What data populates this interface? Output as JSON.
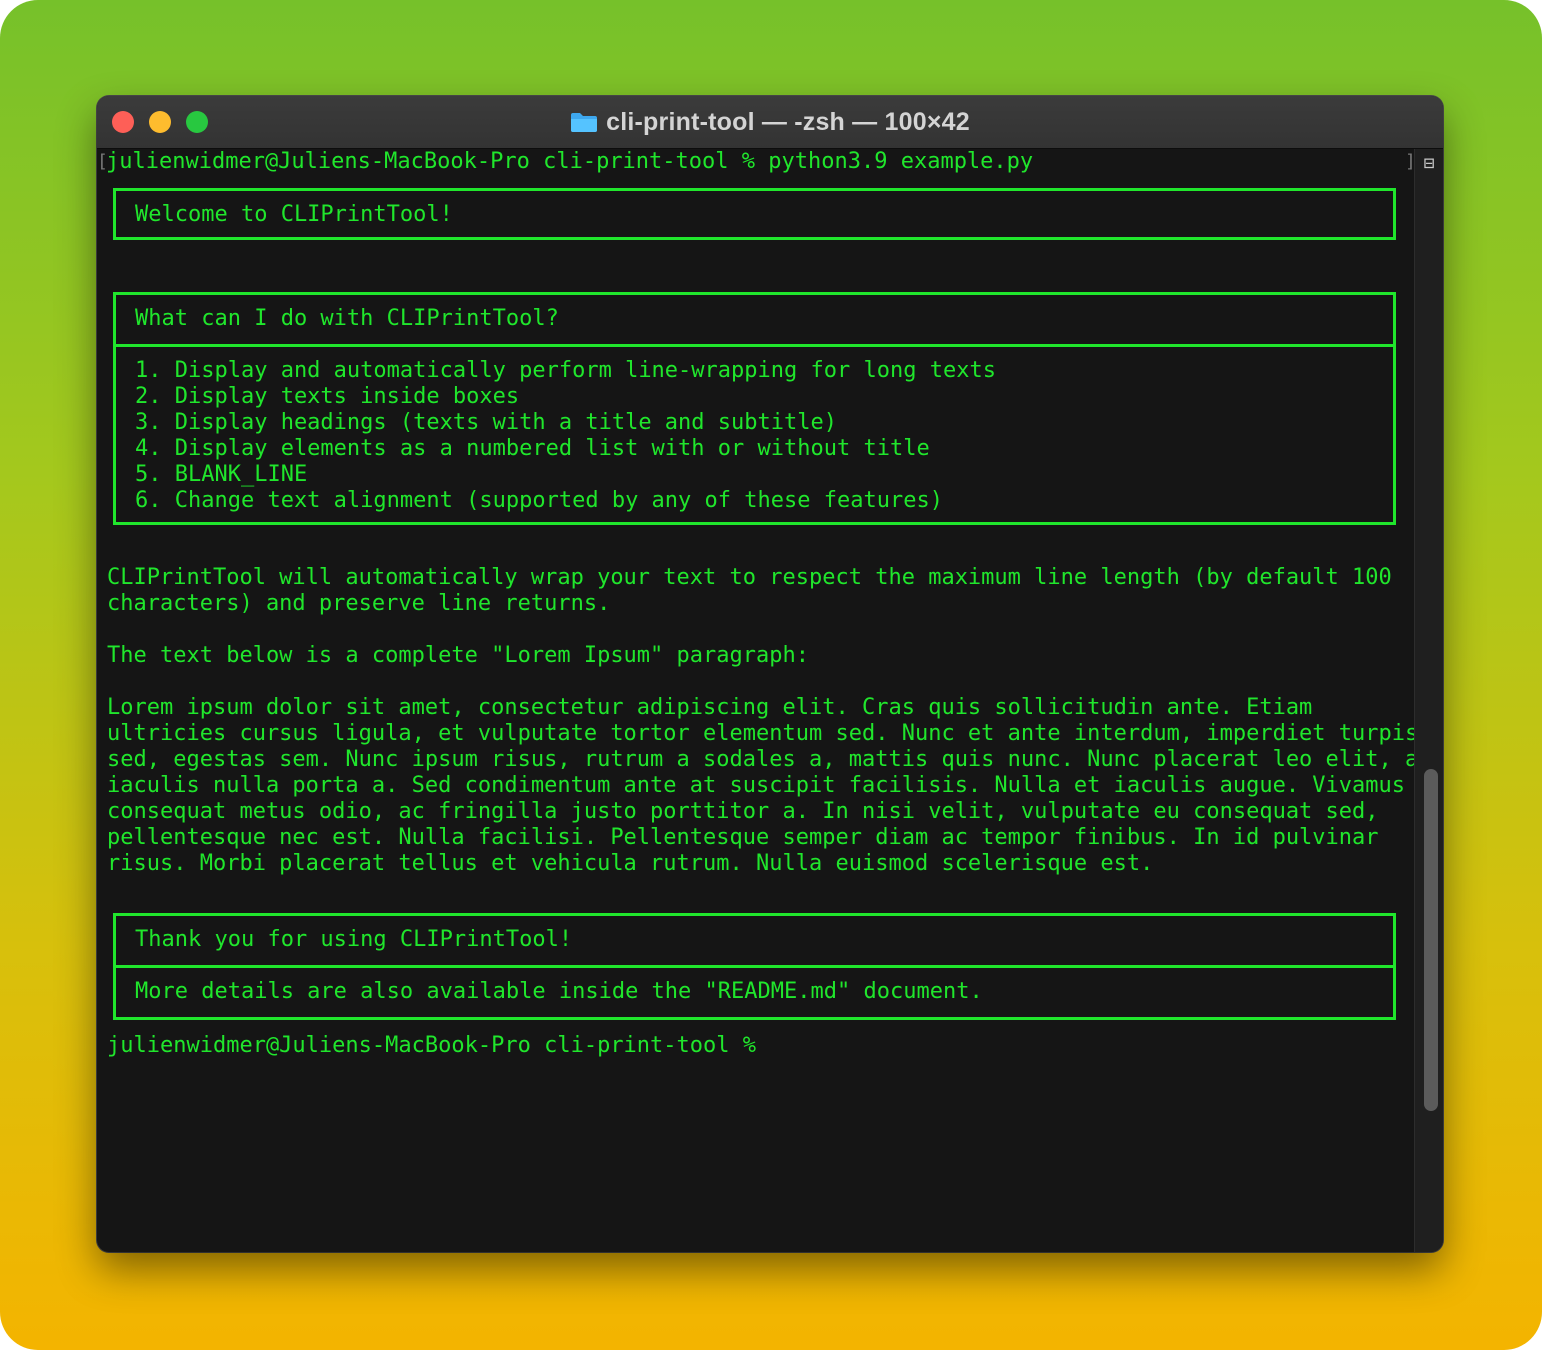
{
  "window": {
    "title": "cli-print-tool — -zsh — 100×42"
  },
  "terminal": {
    "command_line": "julienwidmer@Juliens-MacBook-Pro cli-print-tool % python3.9 example.py",
    "welcome": "Welcome to CLIPrintTool!",
    "features_heading": "What can I do with CLIPrintTool?",
    "features": [
      "1. Display and automatically perform line-wrapping for long texts",
      "2. Display texts inside boxes",
      "3. Display headings (texts with a title and subtitle)",
      "4. Display elements as a numbered list with or without title",
      "5. BLANK_LINE",
      "6. Change text alignment (supported by any of these features)"
    ],
    "paragraph1": [
      "CLIPrintTool will automatically wrap your text to respect the maximum line length (by default 100",
      "characters) and preserve line returns."
    ],
    "paragraph2": "The text below is a complete \"Lorem Ipsum\" paragraph:",
    "lorem": [
      "Lorem ipsum dolor sit amet, consectetur adipiscing elit. Cras quis sollicitudin ante. Etiam",
      "ultricies cursus ligula, et vulputate tortor elementum sed. Nunc et ante interdum, imperdiet turpis",
      "sed, egestas sem. Nunc ipsum risus, rutrum a sodales a, mattis quis nunc. Nunc placerat leo elit, at",
      "iaculis nulla porta a. Sed condimentum ante at suscipit facilisis. Nulla et iaculis augue. Vivamus",
      "consequat metus odio, ac fringilla justo porttitor a. In nisi velit, vulputate eu consequat sed,",
      "pellentesque nec est. Nulla facilisi. Pellentesque semper diam ac tempor finibus. In id pulvinar",
      "risus. Morbi placerat tellus et vehicula rutrum. Nulla euismod scelerisque est."
    ],
    "thanks_title": "Thank you for using CLIPrintTool!",
    "thanks_subtitle": "More details are also available inside the \"README.md\" document.",
    "prompt": "julienwidmer@Juliens-MacBook-Pro cli-print-tool %"
  },
  "icons": {
    "folder": "folder-icon",
    "scroll_marker": "split-view-icon"
  },
  "colors": {
    "text_green": "#20e62c",
    "terminal_bg": "#151515",
    "close": "#fe5f57",
    "minimize": "#febc2e",
    "maximize": "#28c840"
  }
}
